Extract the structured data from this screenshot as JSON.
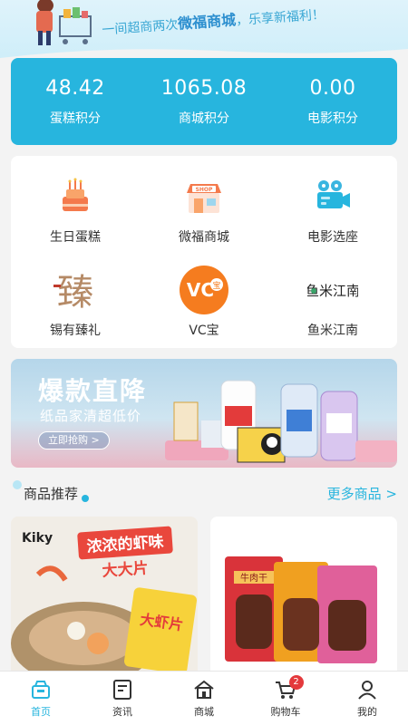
{
  "header": {
    "tagline_prefix": "一间超商两次",
    "tagline_brand": "微福商城",
    "tagline_suffix": "，乐享新福利！"
  },
  "points": [
    {
      "value": "48.42",
      "label": "蛋糕积分"
    },
    {
      "value": "1065.08",
      "label": "商城积分"
    },
    {
      "value": "0.00",
      "label": "电影积分"
    }
  ],
  "services": [
    {
      "label": "生日蛋糕",
      "icon": "birthday-cake-icon"
    },
    {
      "label": "微福商城",
      "icon": "shop-icon"
    },
    {
      "label": "电影选座",
      "icon": "movie-camera-icon"
    },
    {
      "label": "锡有臻礼",
      "icon": "zhen-logo-icon"
    },
    {
      "label": "VC宝",
      "icon": "vc-logo-icon"
    },
    {
      "label": "鱼米江南",
      "icon": "yumi-logo-icon"
    }
  ],
  "promo": {
    "title": "爆款直降",
    "subtitle": "纸品家清超低价",
    "button": "立即抢购 >"
  },
  "recommend": {
    "title": "商品推荐",
    "more": "更多商品 >"
  },
  "products": [
    {
      "brand": "Kiky",
      "headline": "浓浓的虾味",
      "headline2": "大大片",
      "pack": "大虾片"
    },
    {
      "pack": "牛肉干"
    }
  ],
  "tabs": [
    {
      "label": "首页",
      "icon": "home-icon",
      "active": true
    },
    {
      "label": "资讯",
      "icon": "news-icon"
    },
    {
      "label": "商城",
      "icon": "store-icon"
    },
    {
      "label": "购物车",
      "icon": "cart-icon",
      "badge": "2"
    },
    {
      "label": "我的",
      "icon": "profile-icon"
    }
  ],
  "colors": {
    "accent": "#27b5de",
    "badge": "#e4393c"
  }
}
